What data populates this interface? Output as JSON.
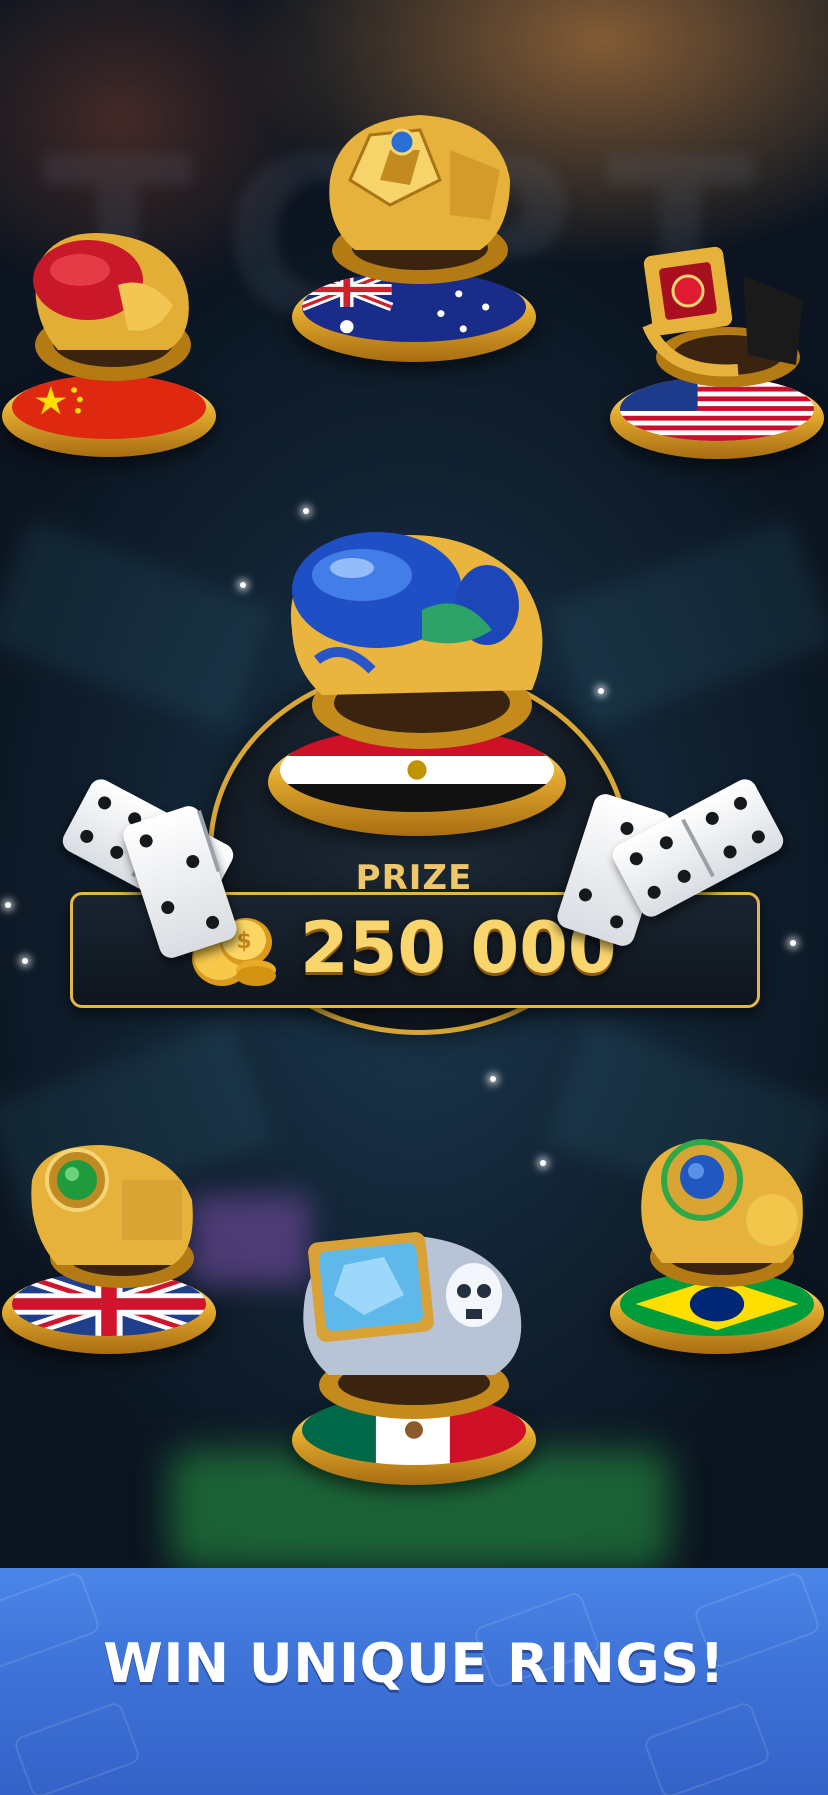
{
  "prize": {
    "label": "PRIZE",
    "amount": "250 000",
    "currency_icon": "gold-coins-icon"
  },
  "banner": {
    "title": "WIN UNIQUE RINGS!"
  },
  "rings": [
    {
      "country": "China",
      "gem_color": "#c8182a",
      "flag_icon": "china-flag-icon"
    },
    {
      "country": "Australia",
      "gem_color": "#2a6fd6",
      "flag_icon": "australia-flag-icon"
    },
    {
      "country": "USA",
      "gem_color": "#d41c2c",
      "flag_icon": "usa-flag-icon"
    },
    {
      "country": "Egypt",
      "gem_color": "#2a5cd4",
      "flag_icon": "egypt-flag-icon"
    },
    {
      "country": "United Kingdom",
      "gem_color": "#1f9a3c",
      "flag_icon": "uk-flag-icon"
    },
    {
      "country": "Mexico",
      "gem_color": "#7cc6f2",
      "flag_icon": "mexico-flag-icon"
    },
    {
      "country": "Brazil",
      "gem_color": "#2058c0",
      "flag_icon": "brazil-flag-icon"
    }
  ],
  "colors": {
    "gold": "#e2aa2e",
    "banner_blue": "#4a86e8",
    "prize_text": "#f9d56e"
  }
}
